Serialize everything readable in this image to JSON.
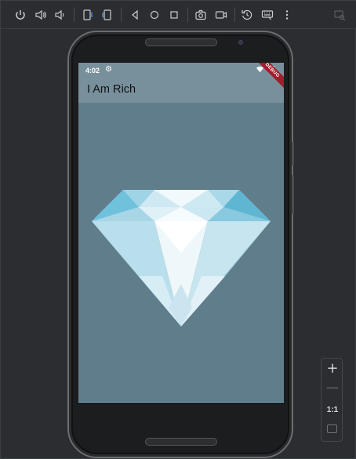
{
  "toolbar": {
    "icons": [
      "power-icon",
      "volume-up-icon",
      "volume-down-icon",
      "rotate-left-icon",
      "rotate-right-icon",
      "back-icon",
      "home-icon",
      "overview-icon",
      "screenshot-icon",
      "screen-record-icon",
      "restore-snapshot-icon",
      "extended-controls-icon",
      "more-options-icon",
      "device-mirror-icon"
    ]
  },
  "status_bar": {
    "time": "4:02",
    "gear": "⚙"
  },
  "app_bar": {
    "title": "I Am Rich"
  },
  "debug_banner": {
    "label": "DEBUG"
  },
  "colors": {
    "screen_background": "#607d8b",
    "app_bar": "#78909c",
    "debug_banner": "#a01e2b",
    "diamond_light": "#e8f4f8",
    "diamond_mid": "#b8dce8",
    "diamond_dark": "#5fb6d2"
  },
  "zoom": {
    "plus": "+",
    "minus": "—",
    "one_to_one": "1:1"
  }
}
